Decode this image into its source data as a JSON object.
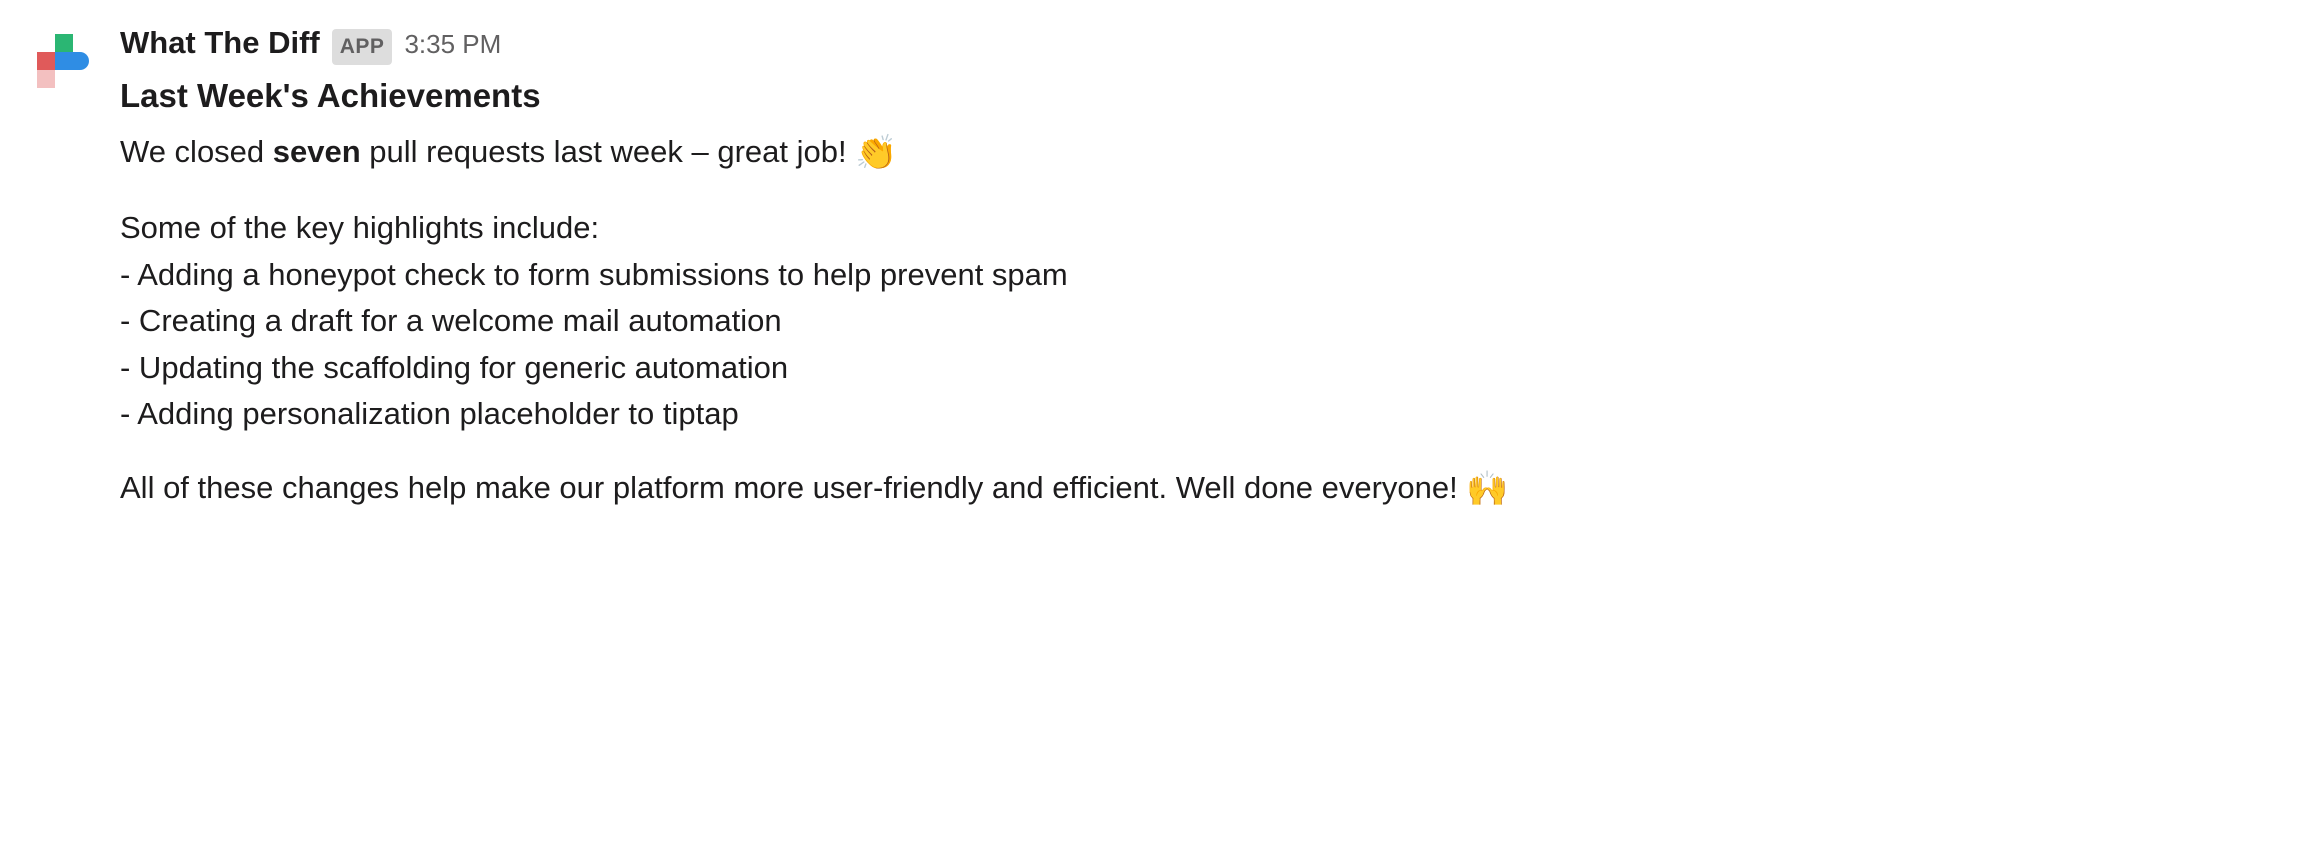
{
  "header": {
    "sender_name": "What The Diff",
    "app_badge": "APP",
    "timestamp": "3:35 PM"
  },
  "title": "Last Week's Achievements",
  "summary": {
    "prefix": "We closed ",
    "count_word": "seven",
    "suffix": " pull requests last week – great job! ",
    "emoji": "👏"
  },
  "highlights_intro": "Some of the key highlights include:",
  "highlights": [
    "- Adding a honeypot check to form submissions to help prevent spam",
    "- Creating a draft for a welcome mail automation",
    "- Updating the scaffolding for generic automation",
    "- Adding personalization placeholder to tiptap"
  ],
  "closing": {
    "text": "All of these changes help make our platform more user-friendly and efficient. Well done everyone! ",
    "emoji": "🙌"
  }
}
